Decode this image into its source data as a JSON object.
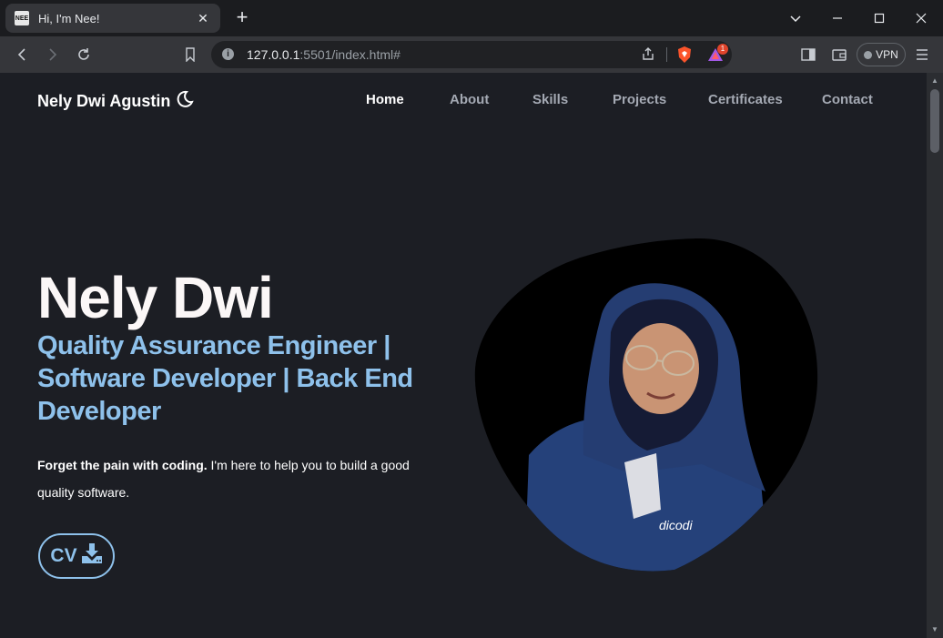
{
  "browser": {
    "tab_title": "Hi, I'm Nee!",
    "favicon_text": "NEE",
    "url_host": "127.0.0.1",
    "url_rest": ":5501/index.html#",
    "vpn_label": "VPN",
    "notification_count": "1"
  },
  "site": {
    "brand": "Nely Dwi Agustin",
    "nav": {
      "home": "Home",
      "about": "About",
      "skills": "Skills",
      "projects": "Projects",
      "certificates": "Certificates",
      "contact": "Contact"
    },
    "hero": {
      "name": "Nely Dwi",
      "roles": "Quality Assurance Engineer | Software Developer | Back End Developer",
      "desc_bold": "Forget the pain with coding.",
      "desc_rest": " I'm here to help you to build a good quality software.",
      "cv_label": "CV",
      "shirt_text": "dicodi"
    }
  },
  "colors": {
    "accent": "#8ec1eb",
    "background": "#1c1e24",
    "blob": "#000000",
    "jacket": "#25417a"
  }
}
